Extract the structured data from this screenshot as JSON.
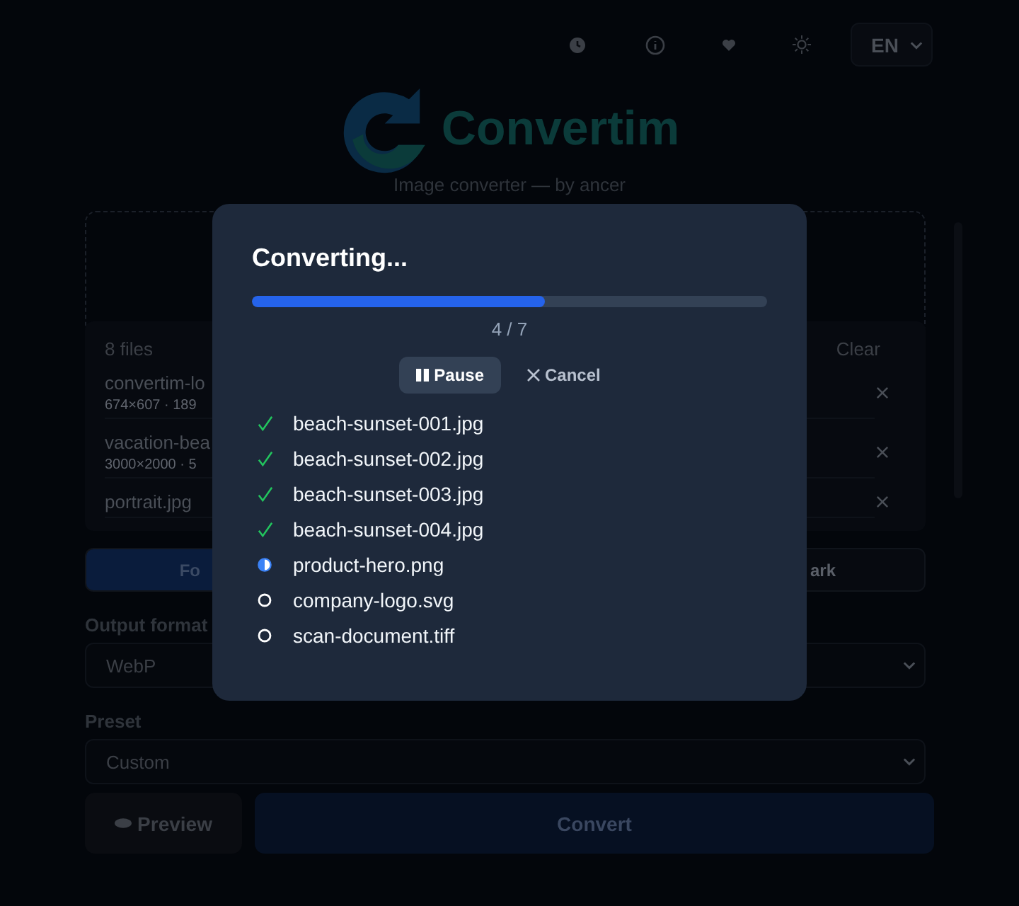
{
  "language": {
    "value": "EN"
  },
  "logo": {
    "name": "Convertim",
    "tagline": "Image converter — by ancer"
  },
  "file_list": {
    "count": "8 files",
    "clear": "Clear",
    "files": [
      {
        "name": "convertim-lo",
        "meta": "674×607 · 189"
      },
      {
        "name": "vacation-bea",
        "meta": "3000×2000 · 5"
      },
      {
        "name": "portrait.jpg"
      }
    ]
  },
  "tabs": [
    {
      "label": "Fo",
      "selected": true
    },
    {
      "label": "ark",
      "selected": false
    }
  ],
  "output_format": {
    "label": "Output format",
    "value": "WebP"
  },
  "preset": {
    "label": "Preset",
    "value": "Custom"
  },
  "actions": {
    "preview": "Preview",
    "convert": "Convert"
  },
  "dialog": {
    "title": "Converting...",
    "level": 0.57,
    "counter": "4 / 7",
    "pause": "Pause",
    "cancel": "Cancel",
    "files": [
      {
        "name": "beach-sunset-001.jpg",
        "kind": "done"
      },
      {
        "name": "beach-sunset-002.jpg",
        "kind": "done"
      },
      {
        "name": "beach-sunset-003.jpg",
        "kind": "done"
      },
      {
        "name": "beach-sunset-004.jpg",
        "kind": "done"
      },
      {
        "name": "product-hero.png",
        "kind": "active"
      },
      {
        "name": "company-logo.svg",
        "kind": "pending"
      },
      {
        "name": "scan-document.tiff",
        "kind": "pending"
      }
    ]
  }
}
